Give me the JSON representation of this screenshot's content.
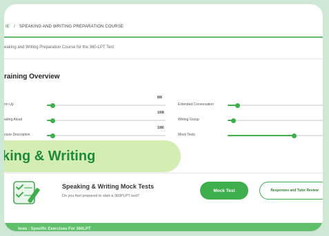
{
  "breadcrumb": {
    "parent": "IE",
    "separator": "/",
    "current": "SPEAKING AND WRITING PREPARATION COURSE"
  },
  "course": {
    "description": "eaking and Writing Preparation Course for the 360-LPT Test"
  },
  "overview": {
    "title": "raining Overview",
    "left_rows": [
      {
        "label": "rm Up",
        "count": "8/8",
        "progress": 0.05
      },
      {
        "label": "ading Aloud",
        "count": "1/68",
        "progress": 0.05
      },
      {
        "label": "cture Description",
        "count": "1/86",
        "progress": 0.05
      }
    ],
    "right_rows": [
      {
        "label": "Extended Conversation",
        "progress": 0.1
      },
      {
        "label": "Writing Group",
        "progress": 0.06
      },
      {
        "label": "Mock Tests",
        "progress": 0.69
      }
    ]
  },
  "badge": {
    "text": "aking & Writing"
  },
  "mock": {
    "title": "Speaking & Writing Mock Tests",
    "subtitle": "Do you feel prepared to start a 360PLPT test?",
    "mock_button": "Mock Test",
    "review_button": "Responses and Tutor Review"
  },
  "footer": {
    "text": "lows : Specific Exercises For 360LPT"
  },
  "colors": {
    "accent": "#3fae4c",
    "badge_bg": "#d4edb3",
    "badge_text": "#1f8a3b",
    "outer_bg": "#cfe8d6"
  },
  "icons": {
    "checklist": "checklist-icon"
  }
}
